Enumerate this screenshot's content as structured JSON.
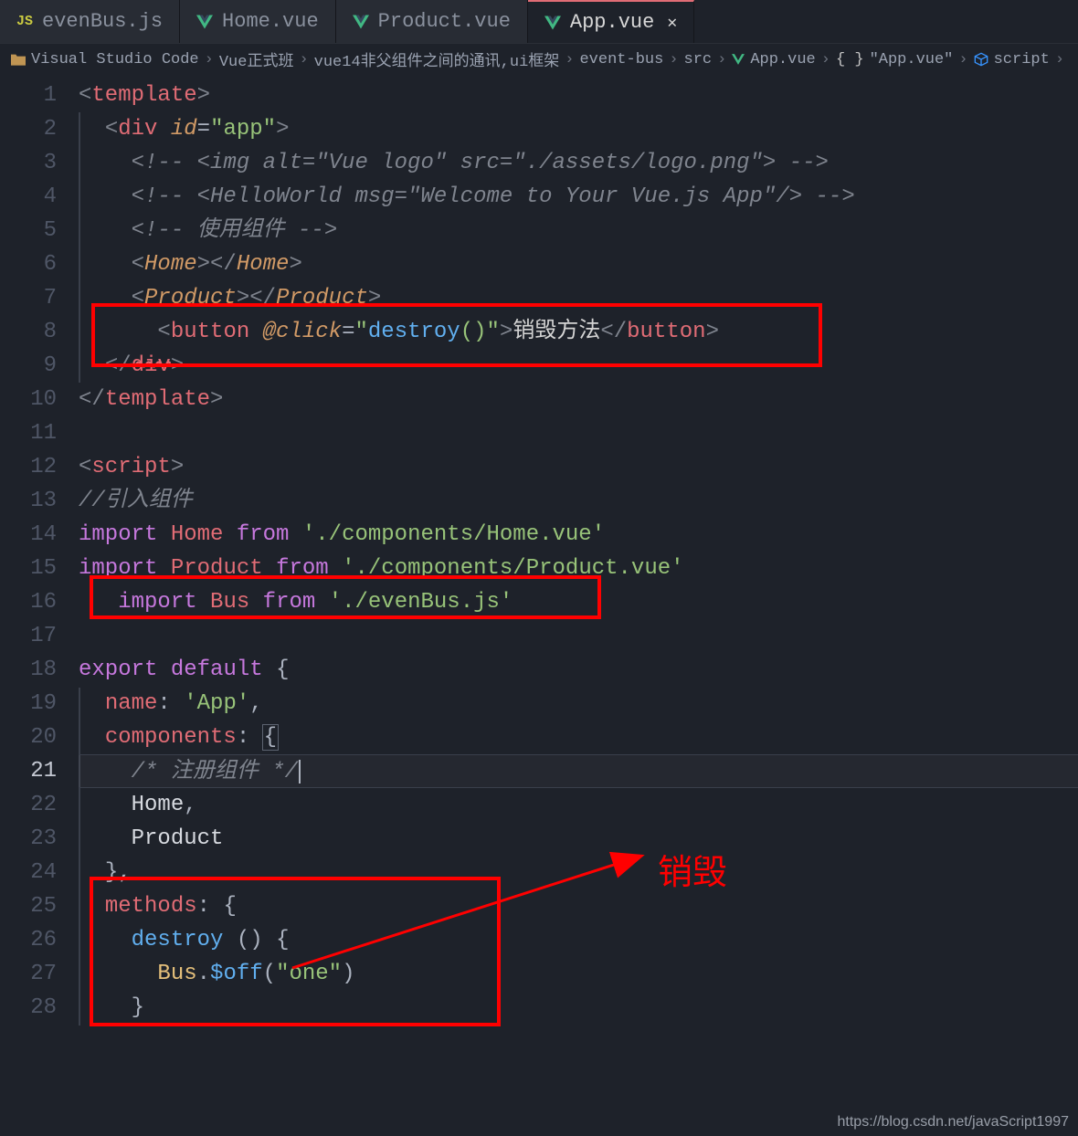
{
  "tabs": [
    {
      "icon": "js",
      "label": "evenBus.js",
      "active": false
    },
    {
      "icon": "vue",
      "label": "Home.vue",
      "active": false
    },
    {
      "icon": "vue",
      "label": "Product.vue",
      "active": false
    },
    {
      "icon": "vue",
      "label": "App.vue",
      "active": true
    }
  ],
  "breadcrumb": {
    "items": [
      {
        "icon": "folder",
        "label": "Visual Studio Code"
      },
      {
        "icon": "",
        "label": "Vue正式班"
      },
      {
        "icon": "",
        "label": "vue14非父组件之间的通讯,ui框架"
      },
      {
        "icon": "",
        "label": "event-bus"
      },
      {
        "icon": "",
        "label": "src"
      },
      {
        "icon": "vue",
        "label": "App.vue"
      },
      {
        "icon": "braces",
        "label": "\"App.vue\""
      },
      {
        "icon": "cube",
        "label": "script"
      }
    ]
  },
  "line_numbers": [
    "1",
    "2",
    "3",
    "4",
    "5",
    "6",
    "7",
    "8",
    "9",
    "10",
    "11",
    "12",
    "13",
    "14",
    "15",
    "16",
    "17",
    "18",
    "19",
    "20",
    "21",
    "22",
    "23",
    "24",
    "25",
    "26",
    "27",
    "28"
  ],
  "active_line": 21,
  "code_text": {
    "l1": "<template>",
    "l2": "  <div id=\"app\">",
    "l3": "    <!-- <img alt=\"Vue logo\" src=\"./assets/logo.png\"> -->",
    "l4": "    <!-- <HelloWorld msg=\"Welcome to Your Vue.js App\"/> -->",
    "l5": "    <!-- 使用组件 -->",
    "l6": "    <Home></Home>",
    "l7": "    <Product></Product>",
    "l8": "      <button @click=\"destroy()\">销毁方法</button>",
    "l9": "  </div>",
    "l10": "</template>",
    "l11": "",
    "l12": "<script>",
    "l13": "//引入组件",
    "l14": "import Home from './components/Home.vue'",
    "l15": "import Product from './components/Product.vue'",
    "l16": "   import Bus from './evenBus.js'",
    "l17": "",
    "l18": "export default {",
    "l19": "  name: 'App',",
    "l20": "  components: {",
    "l21": "    /* 注册组件 */",
    "l22": "    Home,",
    "l23": "    Product",
    "l24": "  },",
    "l25": "  methods: {",
    "l26": "    destroy () {",
    "l27": "      Bus.$off(\"one\")",
    "l28": "    }"
  },
  "annotation": {
    "destroy_label": "销毁"
  },
  "watermark": "https://blog.csdn.net/javaScript1997"
}
